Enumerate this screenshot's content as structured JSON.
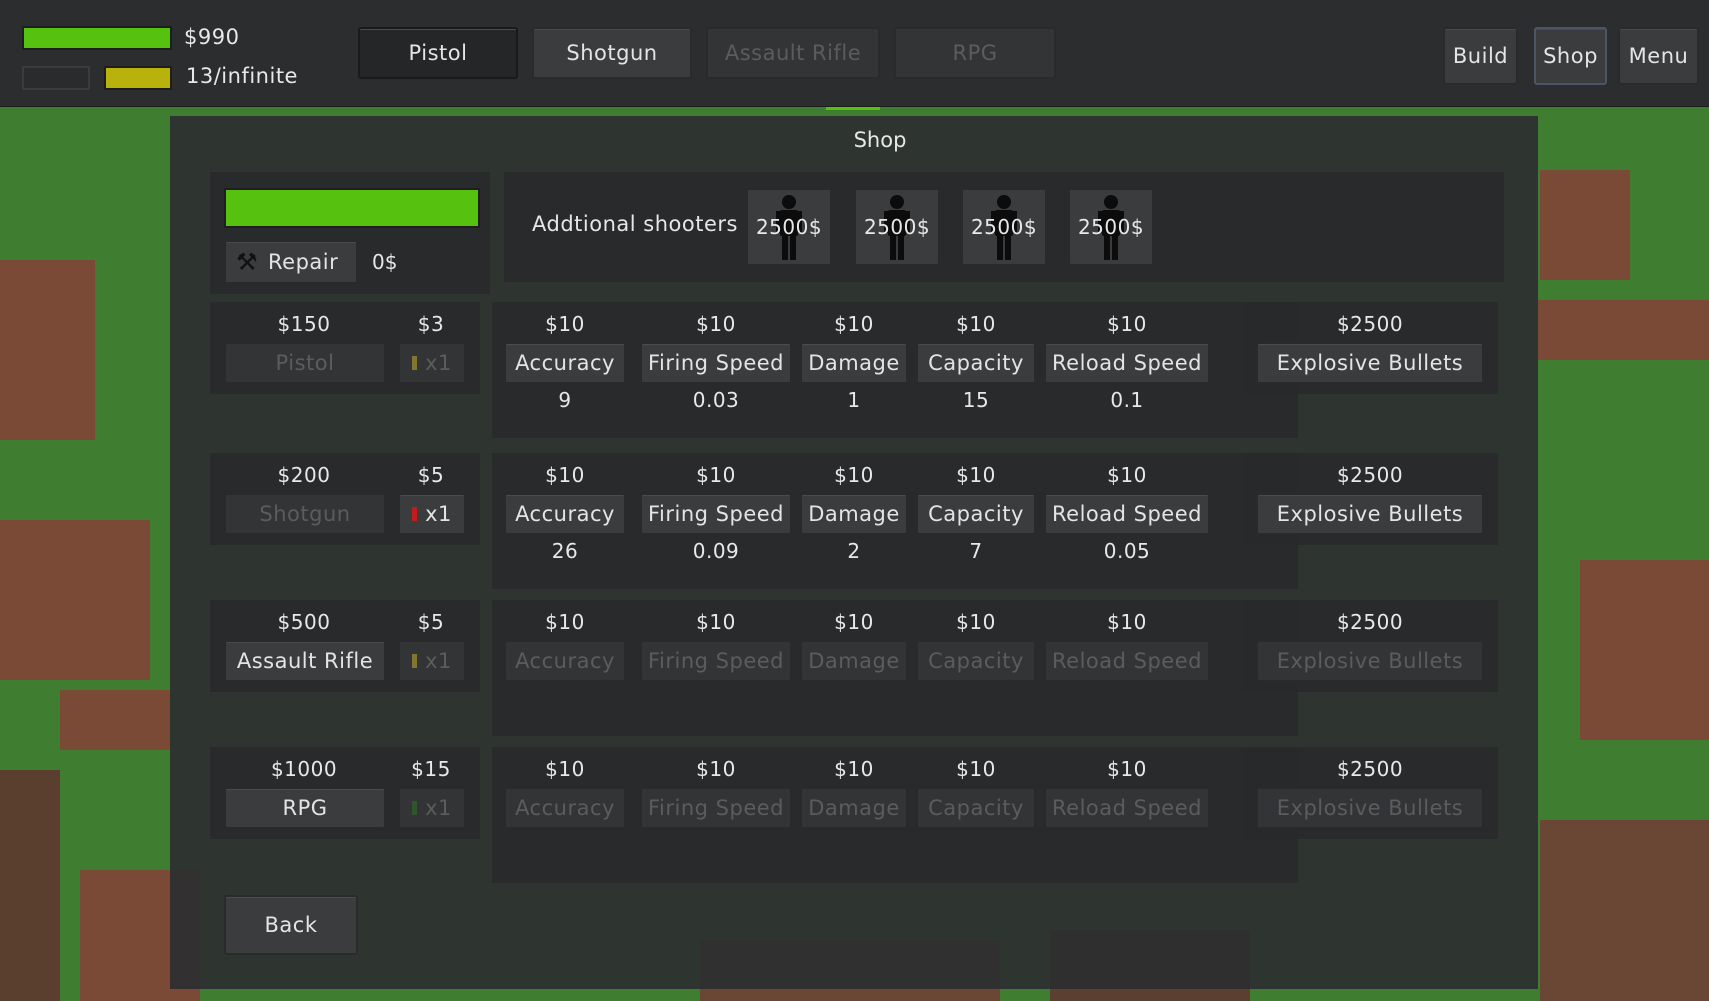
{
  "hud": {
    "money": "$990",
    "ammo": "13/infinite",
    "colors": {
      "health": "#56c20f",
      "ammo": "#b9b20c",
      "empty": "#2a2b2d"
    }
  },
  "weapon_tabs": [
    {
      "label": "Pistol",
      "state": "selected"
    },
    {
      "label": "Shotgun",
      "state": "normal"
    },
    {
      "label": "Assault Rifle",
      "state": "disabled"
    },
    {
      "label": "RPG",
      "state": "disabled"
    }
  ],
  "nav": {
    "build": "Build",
    "shop": "Shop",
    "menu": "Menu"
  },
  "shop": {
    "title": "Shop",
    "repair": {
      "label": "Repair",
      "cost": "0$",
      "icon": "tools-icon"
    },
    "shooters": {
      "label": "Addtional shooters :",
      "items": [
        "2500$",
        "2500$",
        "2500$",
        "2500$"
      ],
      "icon": "person-icon"
    },
    "weapons": [
      {
        "price": "$150",
        "ammo_price": "$3",
        "name": "Pistol",
        "ammo_label": "x1",
        "buy_disabled": true,
        "ammo_disabled": true,
        "ammo_color": "#b9a431",
        "upgrades": [
          {
            "price": "$10",
            "label": "Accuracy",
            "value": "9"
          },
          {
            "price": "$10",
            "label": "Firing Speed",
            "value": "0.03"
          },
          {
            "price": "$10",
            "label": "Damage",
            "value": "1"
          },
          {
            "price": "$10",
            "label": "Capacity",
            "value": "15"
          },
          {
            "price": "$10",
            "label": "Reload Speed",
            "value": "0.1"
          }
        ],
        "upgrades_disabled": false,
        "special": {
          "price": "$2500",
          "label": "Explosive Bullets"
        },
        "special_disabled": false
      },
      {
        "price": "$200",
        "ammo_price": "$5",
        "name": "Shotgun",
        "ammo_label": "x1",
        "buy_disabled": true,
        "ammo_disabled": false,
        "ammo_color": "#c21d1d",
        "upgrades": [
          {
            "price": "$10",
            "label": "Accuracy",
            "value": "26"
          },
          {
            "price": "$10",
            "label": "Firing Speed",
            "value": "0.09"
          },
          {
            "price": "$10",
            "label": "Damage",
            "value": "2"
          },
          {
            "price": "$10",
            "label": "Capacity",
            "value": "7"
          },
          {
            "price": "$10",
            "label": "Reload Speed",
            "value": "0.05"
          }
        ],
        "upgrades_disabled": false,
        "special": {
          "price": "$2500",
          "label": "Explosive Bullets"
        },
        "special_disabled": false
      },
      {
        "price": "$500",
        "ammo_price": "$5",
        "name": "Assault Rifle",
        "ammo_label": "x1",
        "buy_disabled": false,
        "ammo_disabled": true,
        "ammo_color": "#b9a431",
        "upgrades": [
          {
            "price": "$10",
            "label": "Accuracy",
            "value": ""
          },
          {
            "price": "$10",
            "label": "Firing Speed",
            "value": ""
          },
          {
            "price": "$10",
            "label": "Damage",
            "value": ""
          },
          {
            "price": "$10",
            "label": "Capacity",
            "value": ""
          },
          {
            "price": "$10",
            "label": "Reload Speed",
            "value": ""
          }
        ],
        "upgrades_disabled": true,
        "special": {
          "price": "$2500",
          "label": "Explosive Bullets"
        },
        "special_disabled": true
      },
      {
        "price": "$1000",
        "ammo_price": "$15",
        "name": "RPG",
        "ammo_label": "x1",
        "buy_disabled": false,
        "ammo_disabled": true,
        "ammo_color": "#2f6b2a",
        "upgrades": [
          {
            "price": "$10",
            "label": "Accuracy",
            "value": ""
          },
          {
            "price": "$10",
            "label": "Firing Speed",
            "value": ""
          },
          {
            "price": "$10",
            "label": "Damage",
            "value": ""
          },
          {
            "price": "$10",
            "label": "Capacity",
            "value": ""
          },
          {
            "price": "$10",
            "label": "Reload Speed",
            "value": ""
          }
        ],
        "upgrades_disabled": true,
        "special": {
          "price": "$2500",
          "label": "Explosive Bullets"
        },
        "special_disabled": true
      }
    ],
    "back": "Back",
    "health_fraction": 1.0
  }
}
